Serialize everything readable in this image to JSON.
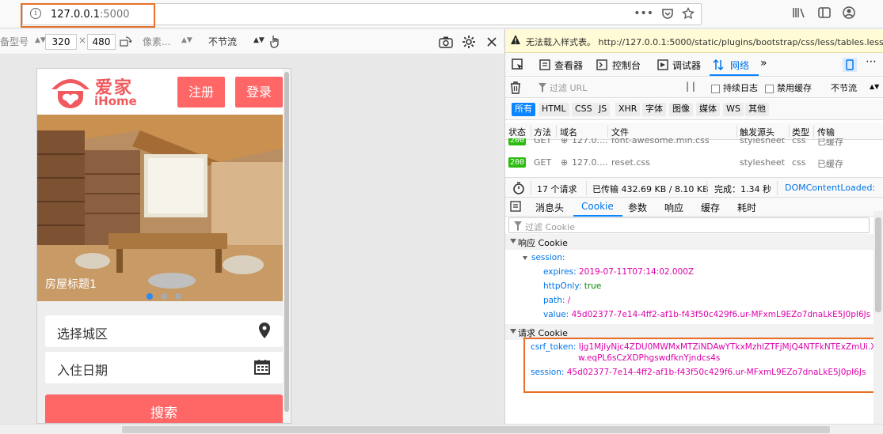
{
  "browser": {
    "url_host": "127.0.0.1",
    "url_port": ":5000",
    "page_actions": "•••"
  },
  "rdm": {
    "device_label": "备型号",
    "width": "320",
    "times": "×",
    "height": "480",
    "dpr_label": "像素...",
    "throttle": "不节流"
  },
  "site": {
    "logo_cn": "爱家",
    "logo_en": "iHome",
    "register": "注册",
    "login": "登录",
    "banner_caption": "房屋标题1",
    "city_placeholder": "选择城区",
    "date_placeholder": "入住日期",
    "search": "搜索"
  },
  "devtools": {
    "warning": "无法载入样式表。 http://127.0.0.1:5000/static/plugins/bootstrap/css/less/tables.less",
    "tabs": [
      "查看器",
      "控制台",
      "调试器",
      "网络"
    ],
    "filter_url_placeholder": "过滤 URL",
    "persist_logs": "持续日志",
    "disable_cache": "禁用缓存",
    "throttle": "不节流",
    "filters": [
      "所有",
      "HTML",
      "CSS",
      "JS",
      "XHR",
      "字体",
      "图像",
      "媒体",
      "WS",
      "其他"
    ],
    "columns": [
      "状态",
      "方法",
      "域名",
      "文件",
      "触发源头",
      "类型",
      "传输"
    ],
    "rows": [
      {
        "status": "200",
        "method": "GET",
        "domain": "127.0....",
        "file": "font-awesome.min.css",
        "cause": "stylesheet",
        "type": "css",
        "transfer": "已缓存"
      },
      {
        "status": "200",
        "method": "GET",
        "domain": "127.0....",
        "file": "reset.css",
        "cause": "stylesheet",
        "type": "css",
        "transfer": "已缓存"
      }
    ],
    "summary": {
      "requests": "17 个请求",
      "transferred": "已传输 432.69 KB / 8.10 KB",
      "finish": "完成：1.34 秒",
      "dom": "DOMContentLoaded:"
    },
    "detail_tabs": [
      "消息头",
      "Cookie",
      "参数",
      "响应",
      "缓存",
      "耗时"
    ],
    "cookie_filter_placeholder": "过滤 Cookie",
    "response_cookie_title": "响应 Cookie",
    "response_cookie": {
      "name": "session:",
      "expires_k": "expires:",
      "expires_v": "2019-07-11T07:14:02.000Z",
      "httponly_k": "httpOnly:",
      "httponly_v": "true",
      "path_k": "path:",
      "path_v": "/",
      "value_k": "value:",
      "value_v": "45d02377-7e14-4ff2-af1b-f43f50c429f6.ur-MFxmL9EZo7dnaLkE5J0pI6Js"
    },
    "request_cookie_title": "请求 Cookie",
    "request_cookie": {
      "csrf_k": "csrf_token:",
      "csrf_v1": "Ijg1MjIyNjc4ZDU0MWMxMTZiNDAwYTkxMzhlZTFjMjQ4NTFkNTExZmUi.X",
      "csrf_v2": "w.eqPL6sCzXDPhgswdfknYjndcs4s",
      "session_k": "session:",
      "session_v": "45d02377-7e14-4ff2-af1b-f43f50c429f6.ur-MFxmL9EZo7dnaLkE5J0pI6Js"
    }
  }
}
